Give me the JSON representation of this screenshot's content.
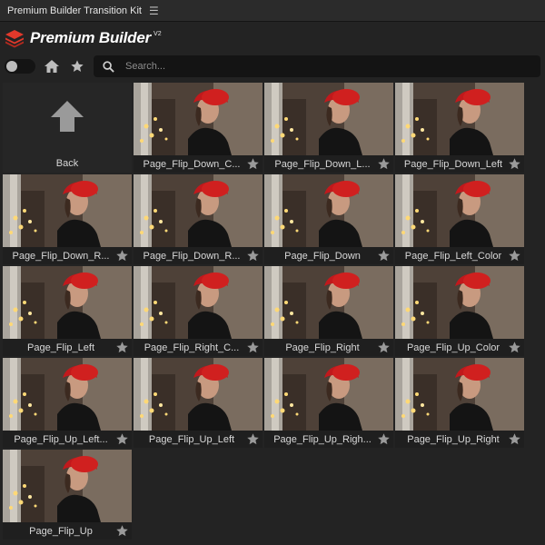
{
  "titlebar": {
    "title": "Premium Builder Transition Kit",
    "menu_icon": "hamburger-menu-icon"
  },
  "brand": {
    "name": "Premium Builder",
    "version": "V2",
    "logo_color": "#e2392b"
  },
  "toolbar": {
    "toggle_state": "off",
    "home_icon": "home-icon",
    "favorites_icon": "star-icon",
    "search_placeholder": "Search...",
    "search_value": ""
  },
  "back": {
    "label": "Back"
  },
  "items": [
    {
      "label": "Page_Flip_Down_C..."
    },
    {
      "label": "Page_Flip_Down_L..."
    },
    {
      "label": "Page_Flip_Down_Left"
    },
    {
      "label": "Page_Flip_Down_R..."
    },
    {
      "label": "Page_Flip_Down_R..."
    },
    {
      "label": "Page_Flip_Down"
    },
    {
      "label": "Page_Flip_Left_Color"
    },
    {
      "label": "Page_Flip_Left"
    },
    {
      "label": "Page_Flip_Right_C..."
    },
    {
      "label": "Page_Flip_Right"
    },
    {
      "label": "Page_Flip_Up_Color"
    },
    {
      "label": "Page_Flip_Up_Left..."
    },
    {
      "label": "Page_Flip_Up_Left"
    },
    {
      "label": "Page_Flip_Up_Righ..."
    },
    {
      "label": "Page_Flip_Up_Right"
    },
    {
      "label": "Page_Flip_Up"
    }
  ],
  "colors": {
    "background": "#232323",
    "card": "#1f1f1f",
    "accent": "#e2392b",
    "star": "#9a9a9a"
  }
}
